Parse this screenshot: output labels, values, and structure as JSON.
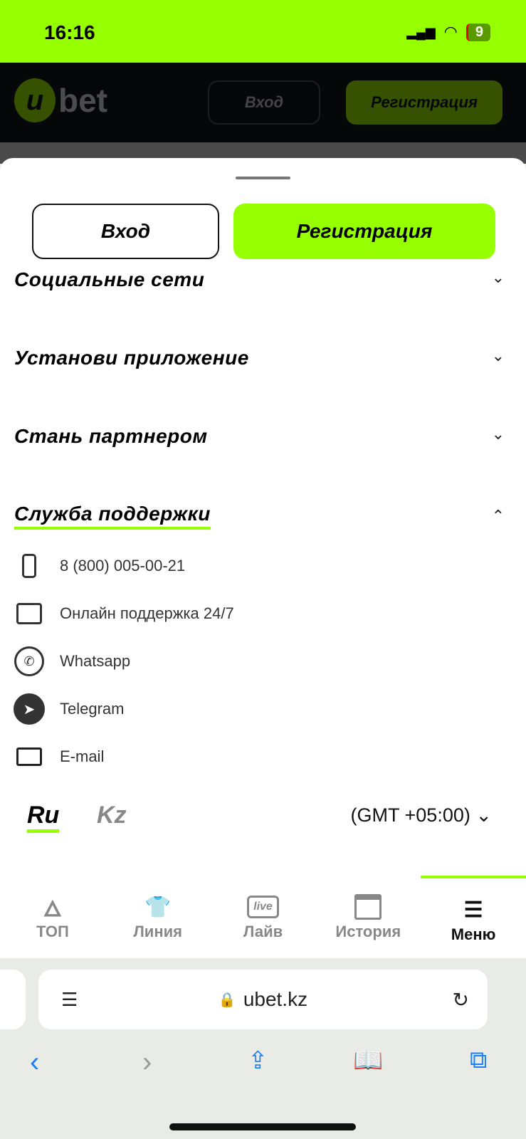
{
  "status": {
    "time": "16:16",
    "battery": "9"
  },
  "header": {
    "logo_u": "u",
    "logo_text": "bet",
    "login": "Вход",
    "register": "Регистрация"
  },
  "sheet": {
    "login": "Вход",
    "register": "Регистрация",
    "sections": [
      {
        "title": "Социальные сети",
        "expanded": false
      },
      {
        "title": "Установи приложение",
        "expanded": false
      },
      {
        "title": "Стань партнером",
        "expanded": false
      },
      {
        "title": "Служба поддержки",
        "expanded": true
      }
    ],
    "support": [
      {
        "icon": "phone-icon",
        "label": "8 (800) 005-00-21"
      },
      {
        "icon": "chat-icon",
        "label": "Онлайн поддержка 24/7"
      },
      {
        "icon": "whatsapp-icon",
        "label": "Whatsapp"
      },
      {
        "icon": "telegram-icon",
        "label": "Telegram"
      },
      {
        "icon": "mail-icon",
        "label": "E-mail"
      }
    ],
    "lang_ru": "Ru",
    "lang_kz": "Kz",
    "timezone": "(GMT +05:00)"
  },
  "nav": [
    {
      "label": "ТОП",
      "icon": "flame-icon"
    },
    {
      "label": "Линия",
      "icon": "shirt-icon"
    },
    {
      "label": "Лайв",
      "icon": "live-icon",
      "badge": "live"
    },
    {
      "label": "История",
      "icon": "calendar-icon"
    },
    {
      "label": "Меню",
      "icon": "menu-icon",
      "active": true
    }
  ],
  "browser": {
    "url": "ubet.kz"
  },
  "colors": {
    "accent": "#96ff00"
  }
}
